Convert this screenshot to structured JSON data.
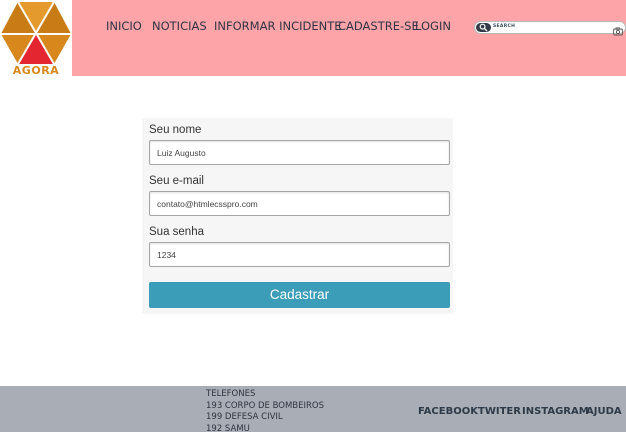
{
  "header": {
    "logo_text": "AGORA",
    "nav": [
      "INICIO",
      "NOTICIAS",
      "INFORMAR INCIDENTE",
      "CADASTRE-SE",
      "LOGIN"
    ],
    "search_placeholder": "SEARCH"
  },
  "form": {
    "name_label": "Seu nome",
    "name_value": "Luiz Augusto",
    "email_label": "Seu e-mail",
    "email_value": "contato@htmlecsspro.com",
    "password_label": "Sua senha",
    "password_value": "1234",
    "submit_label": "Cadastrar"
  },
  "footer": {
    "phones_title": "TELEFONES",
    "phones": [
      "193 CORPO DE BOMBEIROS",
      "199 DEFESA CIVIL",
      "192 SAMU"
    ],
    "social": [
      "FACEBOOK",
      "TWITER",
      "INSTAGRAM",
      "AJUDA"
    ]
  },
  "colors": {
    "header_bg": "#fda4a8",
    "footer_bg": "#a9adb5",
    "button_bg": "#3b9db8",
    "logo_orange": "#d8871c",
    "logo_red": "#e3262f"
  },
  "icons": {
    "logo": "hexagon-logo-icon",
    "search": "search-icon",
    "camera": "camera-icon"
  }
}
